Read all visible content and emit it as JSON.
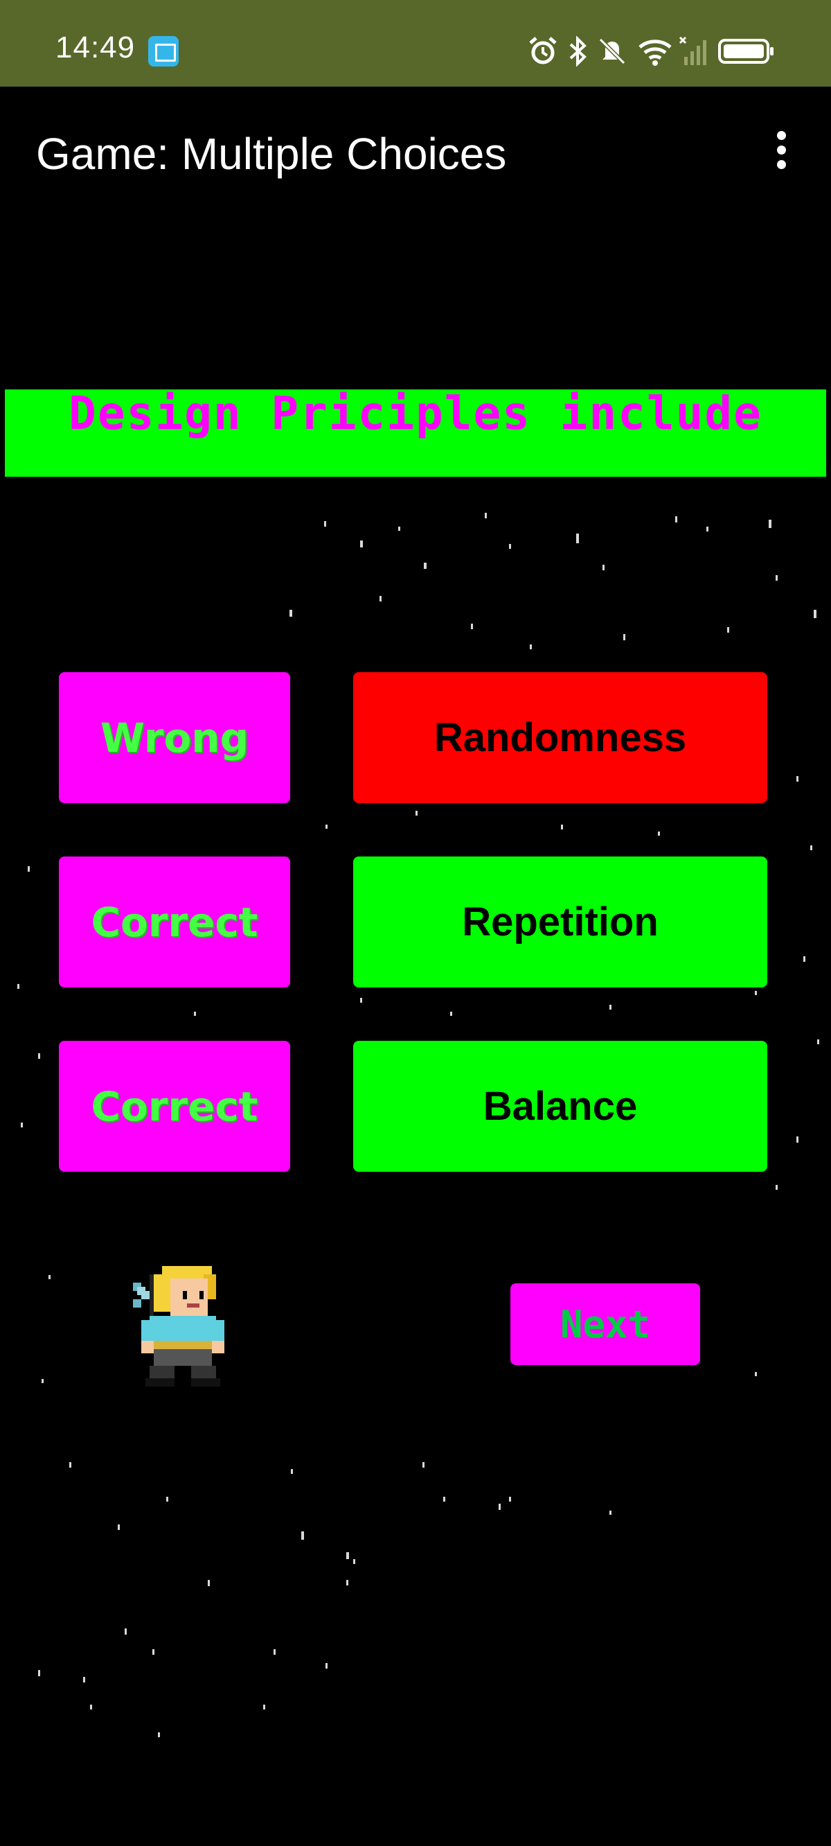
{
  "status_bar": {
    "time": "14:49",
    "icons": [
      "book-app-icon",
      "alarm-icon",
      "bluetooth-icon",
      "mute-icon",
      "wifi-icon",
      "signal-icon",
      "battery-icon"
    ]
  },
  "app_bar": {
    "title": "Game: Multiple Choices",
    "menu_icon": "more-vert-icon"
  },
  "question": {
    "text": "Design Priciples include"
  },
  "answers": [
    {
      "result": "Wrong",
      "label": "Randomness",
      "color": "#ff0000"
    },
    {
      "result": "Correct",
      "label": "Repetition",
      "color": "#00ff00"
    },
    {
      "result": "Correct",
      "label": "Balance",
      "color": "#00ff00"
    }
  ],
  "next_button": {
    "label": "Next"
  },
  "colors": {
    "status_bar": "#58682a",
    "banner": "#00ff00",
    "magenta": "#ff00ff",
    "wrong": "#ff0000",
    "correct": "#00ff00",
    "background": "#000000"
  },
  "player_icon": "pixel-knight-icon"
}
